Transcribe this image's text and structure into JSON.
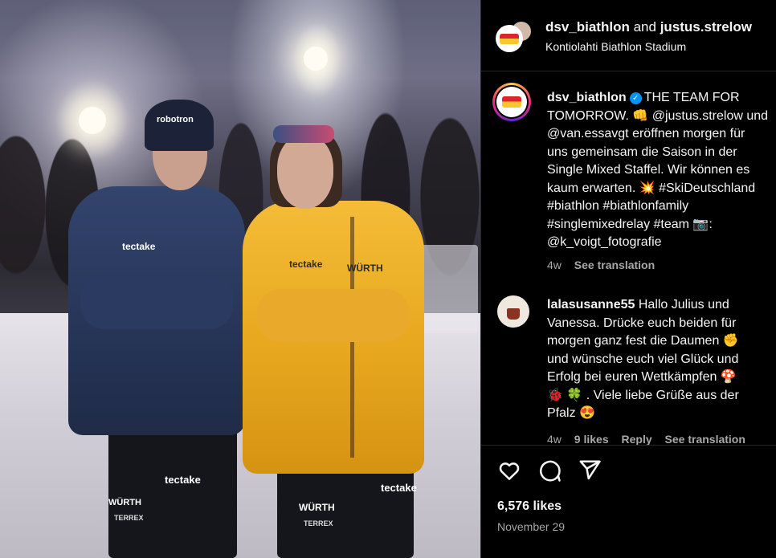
{
  "header": {
    "account_primary": "dsv_biathlon",
    "joiner": "and",
    "account_secondary": "justus.strelow",
    "location": "Kontiolahti Biathlon Stadium"
  },
  "post": {
    "author": "dsv_biathlon",
    "caption_lines": [
      "THE TEAM FOR",
      "TOMORROW. 👊 @justus.strelow und",
      "@van.essavgt eröffnen morgen für",
      "uns gemeinsam die Saison in der",
      "Single Mixed Staffel. Wir können es",
      "kaum erwarten. 💥 #SkiDeutschland",
      "#biathlon #biathlonfamily",
      "#singlemixedrelay #team 📷:",
      "@k_voigt_fotografie"
    ],
    "age": "4w",
    "see_translation": "See translation"
  },
  "comment": {
    "author": "lalasusanne55",
    "lines": [
      "Hallo Julius und",
      "Vanessa. Drücke euch beiden für",
      "morgen ganz fest die Daumen ✊",
      "und wünsche euch viel Glück und",
      "Erfolg bei euren Wettkämpfen 🍄",
      "🐞 🍀 . Viele liebe Grüße aus der",
      "Pfalz 😍"
    ],
    "age": "4w",
    "likes": "9 likes",
    "reply": "Reply",
    "see_translation": "See translation"
  },
  "actions": {
    "like_icon": "heart-icon",
    "comment_icon": "comment-bubble-icon",
    "share_icon": "paper-plane-icon"
  },
  "stats": {
    "likes": "6,576 likes",
    "date": "November 29"
  },
  "photo": {
    "jacket_logo_1": "robotron",
    "jacket_logo_2": "tectake",
    "jacket_logo_3": "WÜRTH",
    "jacket_logo_4": "TERREX"
  },
  "colors": {
    "background": "#000000",
    "text": "#f5f5f5",
    "muted": "#a8a8a8",
    "verified": "#0095f6",
    "divider": "#262626"
  }
}
